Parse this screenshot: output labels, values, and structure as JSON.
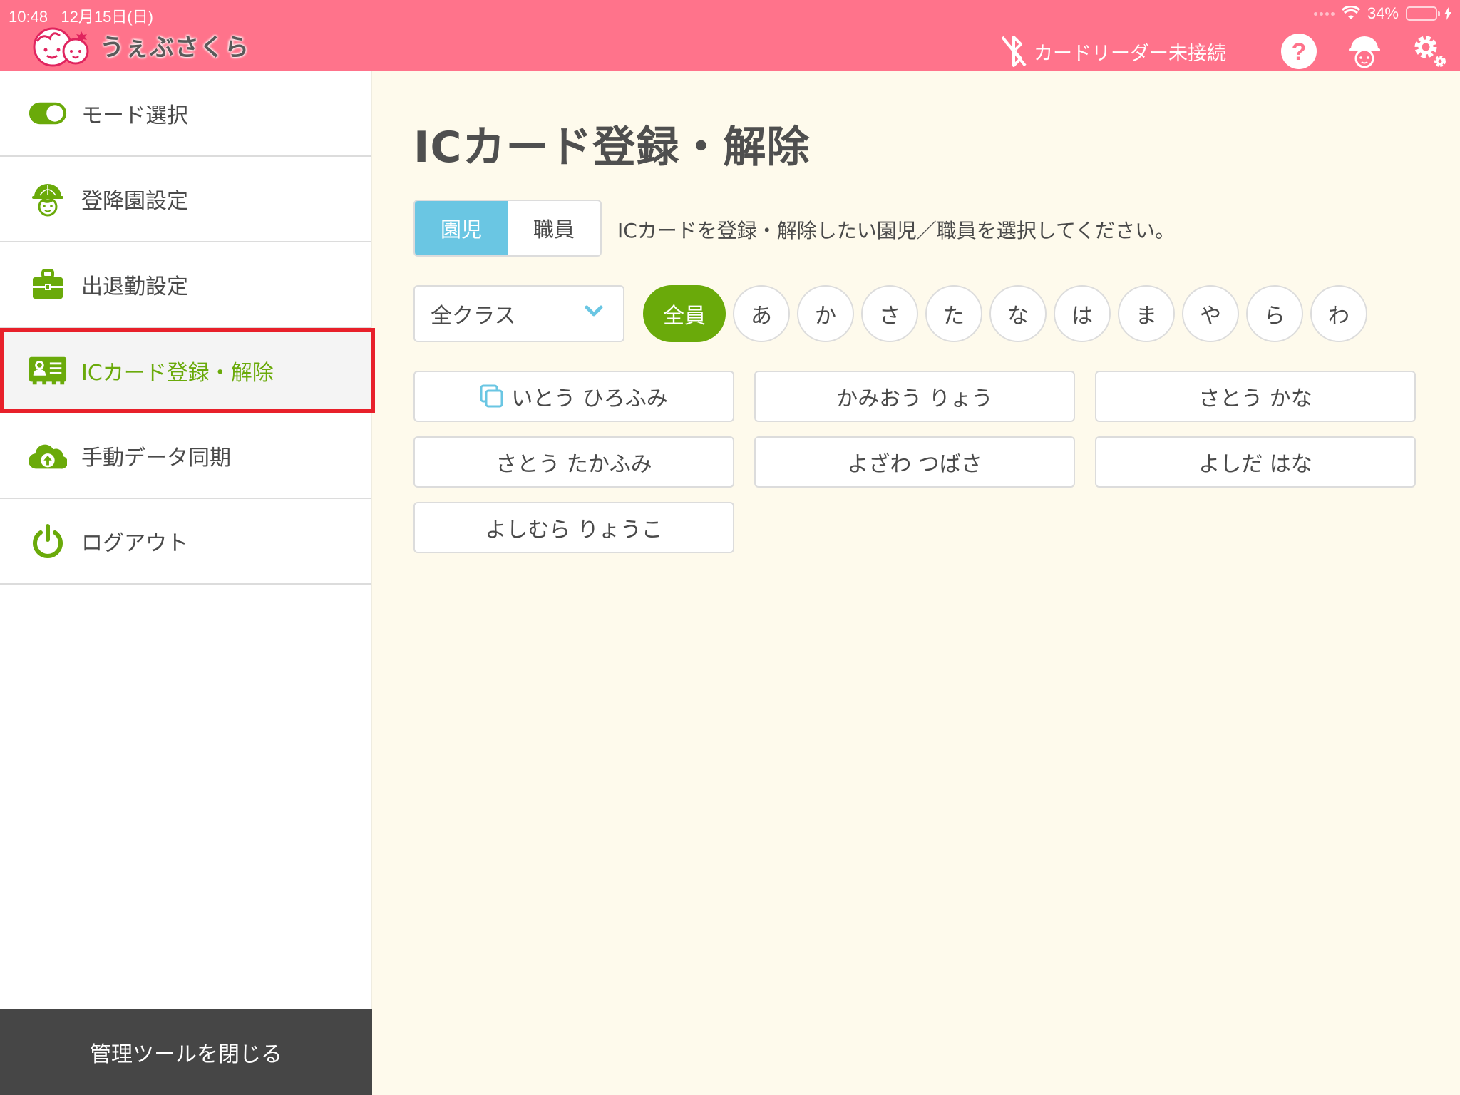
{
  "status_bar": {
    "time": "10:48",
    "date": "12月15日(日)",
    "battery_text": "34%",
    "battery_level": 0.34,
    "battery_color": "#4cd964"
  },
  "header": {
    "app_name": "うぇぶさくら",
    "reader_status": "カードリーダー未接続",
    "icons": [
      "bluetooth-disabled-icon",
      "help-icon",
      "child-helmet-icon",
      "settings-icon"
    ],
    "background_color": "#ff738b"
  },
  "sidebar": {
    "items": [
      {
        "label": "モード選択",
        "icon": "toggle-icon",
        "active": false
      },
      {
        "label": "登降園設定",
        "icon": "child-helmet-icon",
        "active": false
      },
      {
        "label": "出退勤設定",
        "icon": "briefcase-icon",
        "active": false
      },
      {
        "label": "ICカード登録・解除",
        "icon": "id-card-icon",
        "active": true
      },
      {
        "label": "手動データ同期",
        "icon": "cloud-upload-icon",
        "active": false
      },
      {
        "label": "ログアウト",
        "icon": "power-icon",
        "active": false
      }
    ],
    "close_label": "管理ツールを閉じる",
    "accent_color": "#6aaa0a",
    "highlight_color": "#e8202a"
  },
  "main": {
    "title": "ICカード登録・解除",
    "segments": [
      {
        "label": "園児",
        "active": true
      },
      {
        "label": "職員",
        "active": false
      }
    ],
    "instruction": "ICカードを登録・解除したい園児／職員を選択してください。",
    "class_select": {
      "value": "全クラス"
    },
    "kana_filters": [
      {
        "label": "全員",
        "active": true
      },
      {
        "label": "あ"
      },
      {
        "label": "か"
      },
      {
        "label": "さ"
      },
      {
        "label": "た"
      },
      {
        "label": "な"
      },
      {
        "label": "は"
      },
      {
        "label": "ま"
      },
      {
        "label": "や"
      },
      {
        "label": "ら"
      },
      {
        "label": "わ"
      }
    ],
    "people": [
      {
        "name": "いとう ひろふみ",
        "registered": true
      },
      {
        "name": "かみおう りょう",
        "registered": false
      },
      {
        "name": "さとう かな",
        "registered": false
      },
      {
        "name": "さとう たかふみ",
        "registered": false
      },
      {
        "name": "よざわ つばさ",
        "registered": false
      },
      {
        "name": "よしだ はな",
        "registered": false
      },
      {
        "name": "よしむら りょうこ",
        "registered": false
      }
    ],
    "segment_active_color": "#6ac6e3",
    "filter_active_color": "#6aaa0a"
  }
}
